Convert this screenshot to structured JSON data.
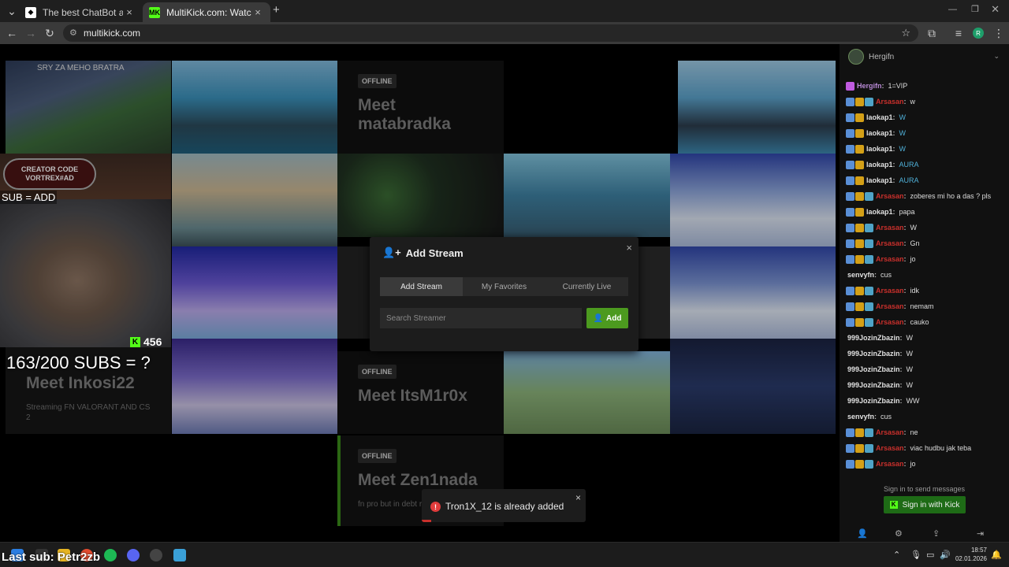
{
  "browser": {
    "tabs": [
      {
        "title": "The best ChatBot and Widgets",
        "active": false
      },
      {
        "title": "MultiKick.com: Watch Multiple",
        "active": true
      }
    ],
    "new_tab": "+",
    "url": "multikick.com"
  },
  "streams": {
    "offline_badge": "OFFLINE",
    "offline_cards": [
      {
        "title": "Meet matabradka",
        "description": ""
      },
      {
        "title": "Meet Inkosi22",
        "description": "Streaming FN VALORANT AND CS 2"
      },
      {
        "title": "Meet ItsM1r0x",
        "description": ""
      },
      {
        "title": "Meet Zen1nada",
        "description": "fn pro but in debt r"
      }
    ],
    "stream_text": {
      "top_left_banner": "SRY ZA MEHO BRATRA",
      "creator_code": "CREATOR CODE VORTREX#AD"
    }
  },
  "overlay": {
    "sub_add": "SUB = ADD",
    "subs_goal": "163/200 SUBS = ?",
    "viewer_count": "456",
    "last_sub": "Last sub: Petr2zb"
  },
  "modal": {
    "title": "Add Stream",
    "close": "×",
    "tabs": [
      "Add Stream",
      "My Favorites",
      "Currently Live"
    ],
    "active_tab": 0,
    "search_placeholder": "Search Streamer",
    "add_button": "Add"
  },
  "toast": {
    "message": "Tron1X_12 is already added",
    "close": "×",
    "progress": 0.06
  },
  "chat": {
    "channel": "Hergifn",
    "messages": [
      {
        "user": "Hergifn",
        "color": "#b98ad6",
        "text": "1=VIP",
        "badges": [
          "b4"
        ]
      },
      {
        "user": "Arsasan",
        "color": "#c9302c",
        "text": "w",
        "badges": [
          "b1",
          "b2",
          "b3"
        ]
      },
      {
        "user": "laokap1",
        "color": "#e0e0e0",
        "text": "W",
        "badges": [
          "b1",
          "b2"
        ],
        "text_color": "#4fb0d8"
      },
      {
        "user": "laokap1",
        "color": "#e0e0e0",
        "text": "W",
        "badges": [
          "b1",
          "b2"
        ],
        "text_color": "#4fb0d8"
      },
      {
        "user": "laokap1",
        "color": "#e0e0e0",
        "text": "W",
        "badges": [
          "b1",
          "b2"
        ],
        "text_color": "#4fb0d8"
      },
      {
        "user": "laokap1",
        "color": "#e0e0e0",
        "text": "AURA",
        "badges": [
          "b1",
          "b2"
        ],
        "text_color": "#4fb0d8"
      },
      {
        "user": "laokap1",
        "color": "#e0e0e0",
        "text": "AURA",
        "badges": [
          "b1",
          "b2"
        ],
        "text_color": "#4fb0d8"
      },
      {
        "user": "Arsasan",
        "color": "#c9302c",
        "text": "zoberes mi ho a das ? pls",
        "badges": [
          "b1",
          "b2",
          "b3"
        ]
      },
      {
        "user": "laokap1",
        "color": "#e0e0e0",
        "text": "papa",
        "badges": [
          "b1",
          "b2"
        ]
      },
      {
        "user": "Arsasan",
        "color": "#c9302c",
        "text": "W",
        "badges": [
          "b1",
          "b2",
          "b3"
        ]
      },
      {
        "user": "Arsasan",
        "color": "#c9302c",
        "text": "Gn",
        "badges": [
          "b1",
          "b2",
          "b3"
        ]
      },
      {
        "user": "Arsasan",
        "color": "#c9302c",
        "text": "jo",
        "badges": [
          "b1",
          "b2",
          "b3"
        ]
      },
      {
        "user": "senvyfn",
        "color": "#e0e0e0",
        "text": "cus",
        "badges": []
      },
      {
        "user": "Arsasan",
        "color": "#c9302c",
        "text": "idk",
        "badges": [
          "b1",
          "b2",
          "b3"
        ]
      },
      {
        "user": "Arsasan",
        "color": "#c9302c",
        "text": "nemam",
        "badges": [
          "b1",
          "b2",
          "b3"
        ]
      },
      {
        "user": "Arsasan",
        "color": "#c9302c",
        "text": "cauko",
        "badges": [
          "b1",
          "b2",
          "b3"
        ]
      },
      {
        "user": "999JozinZbazin",
        "color": "#e0e0e0",
        "text": "W",
        "badges": []
      },
      {
        "user": "999JozinZbazin",
        "color": "#e0e0e0",
        "text": "W",
        "badges": []
      },
      {
        "user": "999JozinZbazin",
        "color": "#e0e0e0",
        "text": "W",
        "badges": []
      },
      {
        "user": "999JozinZbazin",
        "color": "#e0e0e0",
        "text": "W",
        "badges": []
      },
      {
        "user": "999JozinZbazin",
        "color": "#e0e0e0",
        "text": "WW",
        "badges": []
      },
      {
        "user": "senvyfn",
        "color": "#e0e0e0",
        "text": "cus",
        "badges": []
      },
      {
        "user": "Arsasan",
        "color": "#c9302c",
        "text": "ne",
        "badges": [
          "b1",
          "b2",
          "b3"
        ]
      },
      {
        "user": "Arsasan",
        "color": "#c9302c",
        "text": "viac hudbu jak teba",
        "badges": [
          "b1",
          "b2",
          "b3"
        ]
      },
      {
        "user": "Arsasan",
        "color": "#c9302c",
        "text": "jo",
        "badges": [
          "b1",
          "b2",
          "b3"
        ]
      }
    ],
    "signin_prompt": "Sign in to send messages",
    "signin_button": "Sign in with Kick"
  },
  "taskbar": {
    "time": "18:57",
    "date": "02.01.2026"
  },
  "colors": {
    "kick_green": "#53fc18",
    "add_button": "#4c9a1f",
    "error": "#e03c3c"
  }
}
